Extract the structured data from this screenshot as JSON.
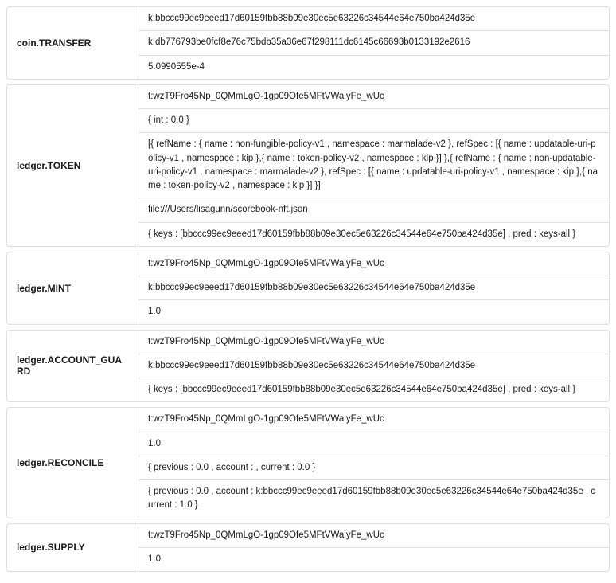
{
  "events": [
    {
      "name": "coin.TRANSFER",
      "values": [
        "k:bbccc99ec9eeed17d60159fbb88b09e30ec5e63226c34544e64e750ba424d35e",
        "k:db776793be0fcf8e76c75bdb35a36e67f298111dc6145c66693b0133192e2616",
        "5.0990555e-4"
      ]
    },
    {
      "name": "ledger.TOKEN",
      "values": [
        "t:wzT9Fro45Np_0QMmLgO-1gp09Ofe5MFtVWaiyFe_wUc",
        "{ int : 0.0 }",
        "[{ refName : { name : non-fungible-policy-v1 , namespace : marmalade-v2 }, refSpec : [{ name : updatable-uri-policy-v1 , namespace : kip },{ name : token-policy-v2 , namespace : kip }] },{ refName : { name : non-updatable-uri-policy-v1 , namespace : marmalade-v2 }, refSpec : [{ name : updatable-uri-policy-v1 , namespace : kip },{ name : token-policy-v2 , namespace : kip }] }]",
        "file:///Users/lisagunn/scorebook-nft.json",
        "{ keys : [bbccc99ec9eeed17d60159fbb88b09e30ec5e63226c34544e64e750ba424d35e] , pred : keys-all }"
      ]
    },
    {
      "name": "ledger.MINT",
      "values": [
        "t:wzT9Fro45Np_0QMmLgO-1gp09Ofe5MFtVWaiyFe_wUc",
        "k:bbccc99ec9eeed17d60159fbb88b09e30ec5e63226c34544e64e750ba424d35e",
        "1.0"
      ]
    },
    {
      "name": "ledger.ACCOUNT_GUARD",
      "values": [
        "t:wzT9Fro45Np_0QMmLgO-1gp09Ofe5MFtVWaiyFe_wUc",
        "k:bbccc99ec9eeed17d60159fbb88b09e30ec5e63226c34544e64e750ba424d35e",
        "{ keys : [bbccc99ec9eeed17d60159fbb88b09e30ec5e63226c34544e64e750ba424d35e] , pred : keys-all }"
      ]
    },
    {
      "name": "ledger.RECONCILE",
      "values": [
        "t:wzT9Fro45Np_0QMmLgO-1gp09Ofe5MFtVWaiyFe_wUc",
        "1.0",
        "{ previous : 0.0 , account : , current : 0.0 }",
        "{ previous : 0.0 , account : k:bbccc99ec9eeed17d60159fbb88b09e30ec5e63226c34544e64e750ba424d35e , current : 1.0 }"
      ]
    },
    {
      "name": "ledger.SUPPLY",
      "values": [
        "t:wzT9Fro45Np_0QMmLgO-1gp09Ofe5MFtVWaiyFe_wUc",
        "1.0"
      ]
    }
  ]
}
